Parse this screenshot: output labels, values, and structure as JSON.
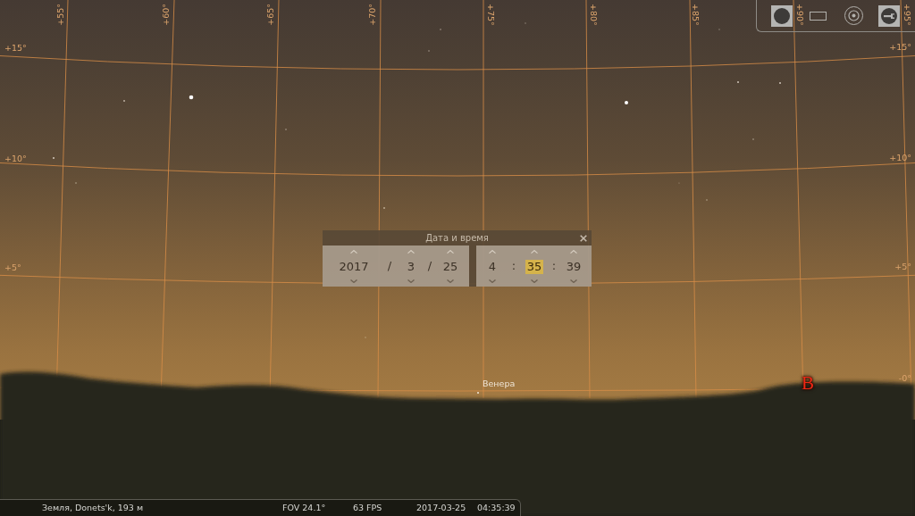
{
  "sky_view": {
    "meridian_labels": [
      "+55°",
      "+60°",
      "+65°",
      "+70°",
      "+75°",
      "+80°",
      "+85°",
      "+90°",
      "+95°"
    ],
    "parallel_labels_left": [
      "+15°",
      "+10°",
      "+5°"
    ],
    "parallel_labels_right": [
      "+15°",
      "+10°",
      "+5°",
      "-0°"
    ],
    "object_labels": [
      "Венера"
    ],
    "cardinal_points": [
      "В"
    ]
  },
  "toolbar": {
    "buttons": [
      {
        "on": true
      },
      {
        "on": false
      },
      {
        "on": false
      },
      {
        "on": true
      }
    ]
  },
  "date_time_dialog": {
    "title": "Дата и время",
    "date_fields": [
      {
        "value": "2017",
        "selected": false
      },
      {
        "value": "3",
        "selected": false
      },
      {
        "value": "25",
        "selected": false
      }
    ],
    "date_separators": [
      "/",
      "/"
    ],
    "time_fields": [
      {
        "value": "4",
        "selected": false
      },
      {
        "value": "35",
        "selected": true
      },
      {
        "value": "39",
        "selected": false
      }
    ],
    "time_separators": [
      ":",
      ":"
    ]
  },
  "status_bar": {
    "location": "Земля, Donets'k, 193 м",
    "fov": "FOV 24.1°",
    "fps": "63 FPS",
    "date": "2017-03-25",
    "time": "04:35:39"
  }
}
